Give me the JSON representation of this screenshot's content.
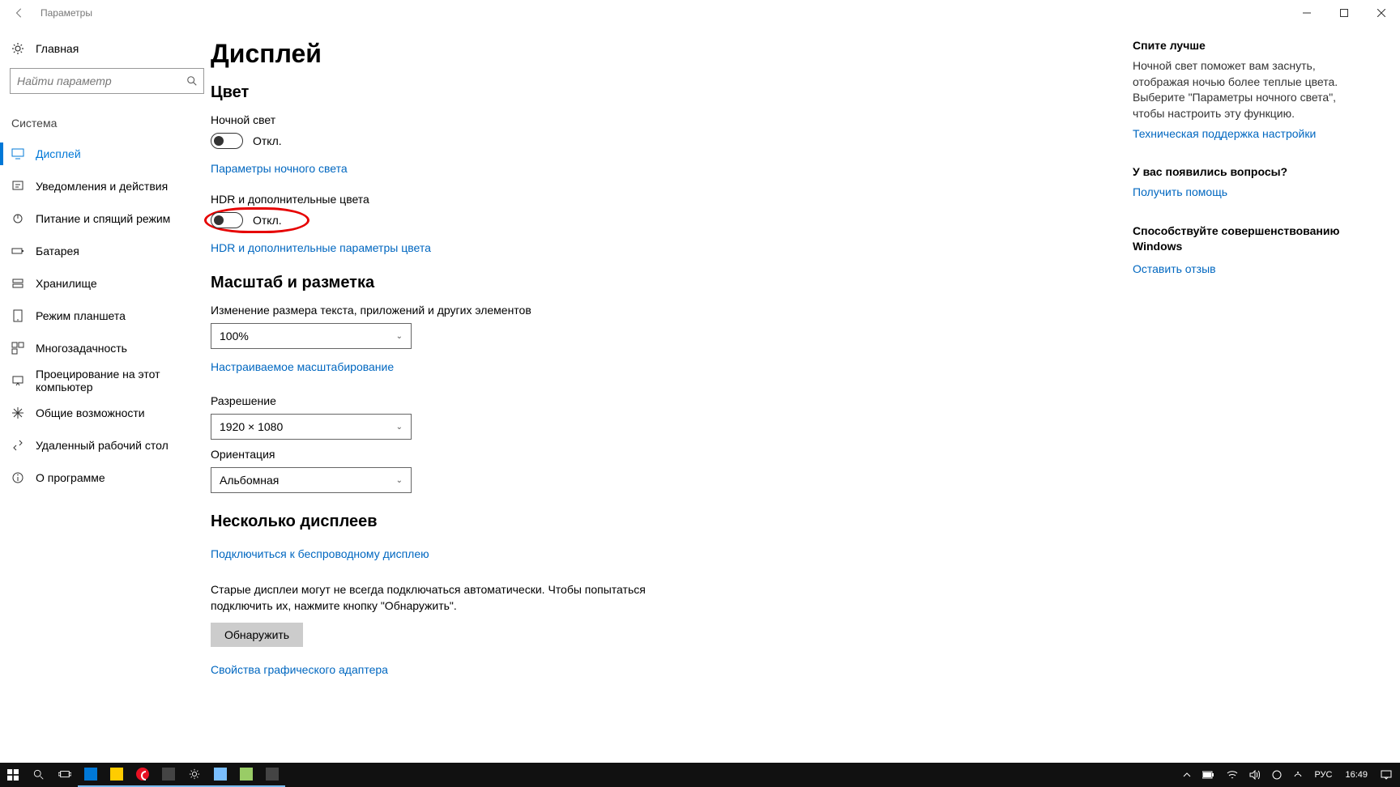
{
  "titlebar": {
    "title": "Параметры"
  },
  "sidebar": {
    "home": "Главная",
    "search_placeholder": "Найти параметр",
    "category": "Система",
    "items": [
      {
        "label": "Дисплей",
        "active": true
      },
      {
        "label": "Уведомления и действия"
      },
      {
        "label": "Питание и спящий режим"
      },
      {
        "label": "Батарея"
      },
      {
        "label": "Хранилище"
      },
      {
        "label": "Режим планшета"
      },
      {
        "label": "Многозадачность"
      },
      {
        "label": "Проецирование на этот компьютер"
      },
      {
        "label": "Общие возможности"
      },
      {
        "label": "Удаленный рабочий стол"
      },
      {
        "label": "О программе"
      }
    ]
  },
  "content": {
    "page_title": "Дисплей",
    "color": {
      "heading": "Цвет",
      "night_light_label": "Ночной свет",
      "night_light_state": "Откл.",
      "night_light_settings_link": "Параметры ночного света",
      "hdr_label": "HDR и дополнительные цвета",
      "hdr_state": "Откл.",
      "hdr_link": "HDR и дополнительные параметры цвета"
    },
    "scale": {
      "heading": "Масштаб и разметка",
      "scale_label": "Изменение размера текста, приложений и других элементов",
      "scale_value": "100%",
      "custom_scaling_link": "Настраиваемое масштабирование",
      "resolution_label": "Разрешение",
      "resolution_value": "1920 × 1080",
      "orientation_label": "Ориентация",
      "orientation_value": "Альбомная"
    },
    "multi": {
      "heading": "Несколько дисплеев",
      "wireless_link": "Подключиться к беспроводному дисплею",
      "detect_desc": "Старые дисплеи могут не всегда подключаться автоматически. Чтобы попытаться подключить их, нажмите кнопку \"Обнаружить\".",
      "detect_btn": "Обнаружить",
      "adapter_link": "Свойства графического адаптера"
    }
  },
  "aside": {
    "sleep_heading": "Спите лучше",
    "sleep_text": "Ночной свет поможет вам заснуть, отображая ночью более теплые цвета. Выберите \"Параметры ночного света\", чтобы настроить эту функцию.",
    "sleep_link": "Техническая поддержка настройки",
    "questions_heading": "У вас появились вопросы?",
    "questions_link": "Получить помощь",
    "improve_heading": "Способствуйте совершенствованию Windows",
    "improve_link": "Оставить отзыв"
  },
  "tray": {
    "lang": "РУС",
    "time": "16:49"
  }
}
